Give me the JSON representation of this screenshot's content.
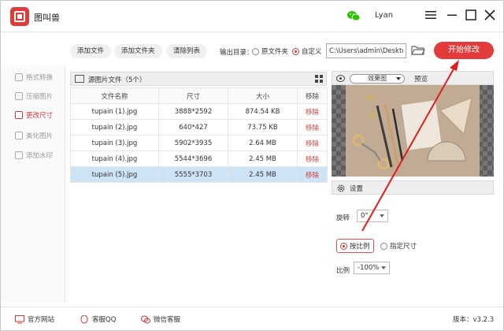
{
  "app": {
    "title": "图叫兽",
    "user": "Lyan"
  },
  "toolbar": {
    "add_file": "添加文件",
    "add_folder": "添加文件夹",
    "clear_list": "清除列表",
    "output_label": "输出目录：",
    "opt_source": "原文件夹",
    "opt_custom": "自定义",
    "output_path": "C:\\Users\\admin\\Desktop",
    "start": "开始修改"
  },
  "sidebar": {
    "items": [
      {
        "label": "格式转换",
        "icon": "convert-icon"
      },
      {
        "label": "压缩图片",
        "icon": "compress-icon"
      },
      {
        "label": "更改尺寸",
        "icon": "resize-icon",
        "active": true
      },
      {
        "label": "美化图片",
        "icon": "beautify-icon"
      },
      {
        "label": "添加水印",
        "icon": "watermark-icon"
      }
    ]
  },
  "files": {
    "title": "源图片文件（5个）",
    "columns": [
      "文件名称",
      "尺寸",
      "大小",
      "移除"
    ],
    "rows": [
      {
        "name": "tupain (1).jpg",
        "dims": "3888*2592",
        "size": "874.54 KB",
        "action": "移除"
      },
      {
        "name": "tupain (2).jpg",
        "dims": "640*427",
        "size": "73.75 KB",
        "action": "移除"
      },
      {
        "name": "tupain (3).jpg",
        "dims": "5902*3935",
        "size": "2.64 MB",
        "action": "移除"
      },
      {
        "name": "tupain (4).jpg",
        "dims": "5544*3696",
        "size": "2.45 MB",
        "action": "移除"
      },
      {
        "name": "tupain (5).jpg",
        "dims": "5555*3703",
        "size": "2.45 MB",
        "action": "移除"
      }
    ],
    "selected_row": 4
  },
  "preview": {
    "mode": "效果图",
    "label": "预览"
  },
  "settings": {
    "title": "设置",
    "rotate_label": "旋转",
    "rotate_value": "0°",
    "mode_ratio": "按比例",
    "mode_size": "指定尺寸",
    "ratio_label": "比例",
    "ratio_value": "-100%"
  },
  "footer": {
    "website": "官方网站",
    "qq": "客服QQ",
    "wechat": "微信客服",
    "version": "版本：v3.2.3"
  },
  "colors": {
    "accent": "#e23b3b",
    "selected_row": "#cfe3f6",
    "wechat": "#2dc100"
  }
}
